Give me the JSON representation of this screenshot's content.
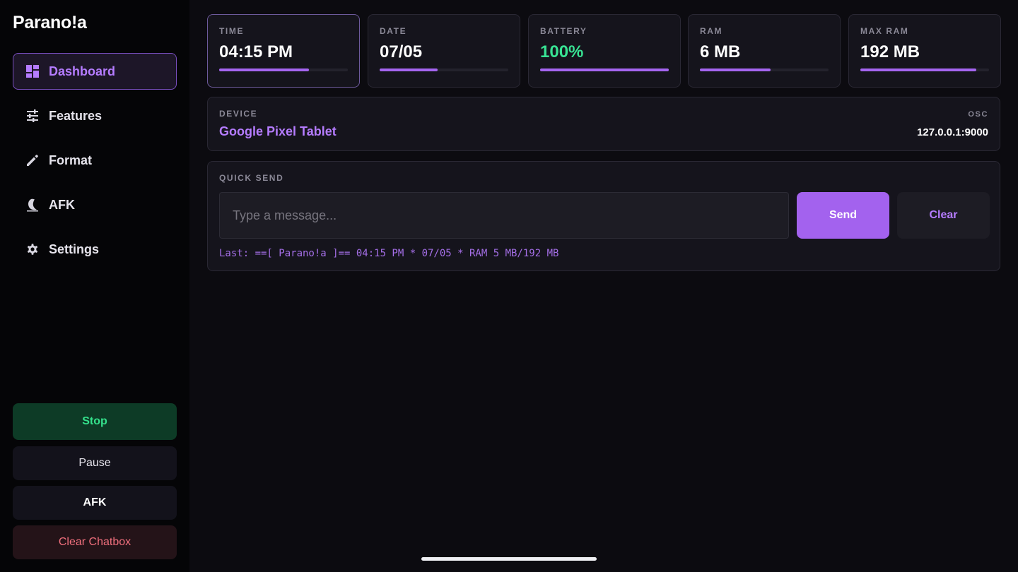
{
  "app": {
    "title": "Parano!a"
  },
  "nav": {
    "items": [
      {
        "label": "Dashboard",
        "icon": "dashboard-icon",
        "active": true
      },
      {
        "label": "Features",
        "icon": "sliders-icon",
        "active": false
      },
      {
        "label": "Format",
        "icon": "pencil-icon",
        "active": false
      },
      {
        "label": "AFK",
        "icon": "moon-icon",
        "active": false
      },
      {
        "label": "Settings",
        "icon": "gear-icon",
        "active": false
      }
    ]
  },
  "actions": {
    "stop": "Stop",
    "pause": "Pause",
    "afk": "AFK",
    "clear_chatbox": "Clear Chatbox"
  },
  "stats": [
    {
      "label": "TIME",
      "value": "04:15 PM",
      "progress": 0.7
    },
    {
      "label": "DATE",
      "value": "07/05",
      "progress": 0.45
    },
    {
      "label": "BATTERY",
      "value": "100%",
      "progress": 1.0
    },
    {
      "label": "RAM",
      "value": "6 MB",
      "progress": 0.55
    },
    {
      "label": "MAX RAM",
      "value": "192 MB",
      "progress": 0.9
    }
  ],
  "device": {
    "label": "DEVICE",
    "name": "Google Pixel Tablet",
    "osc_label": "OSC",
    "osc_value": "127.0.0.1:9000"
  },
  "quick_send": {
    "label": "QUICK SEND",
    "placeholder": "Type a message...",
    "value": "",
    "send_label": "Send",
    "clear_label": "Clear",
    "last": "Last: ==[ Parano!a ]== 04:15 PM * 07/05 * RAM 5 MB/192 MB"
  },
  "colors": {
    "accent": "#a362ee",
    "accent_text": "#b57cff",
    "success": "#38e293",
    "danger": "#f2707e"
  }
}
